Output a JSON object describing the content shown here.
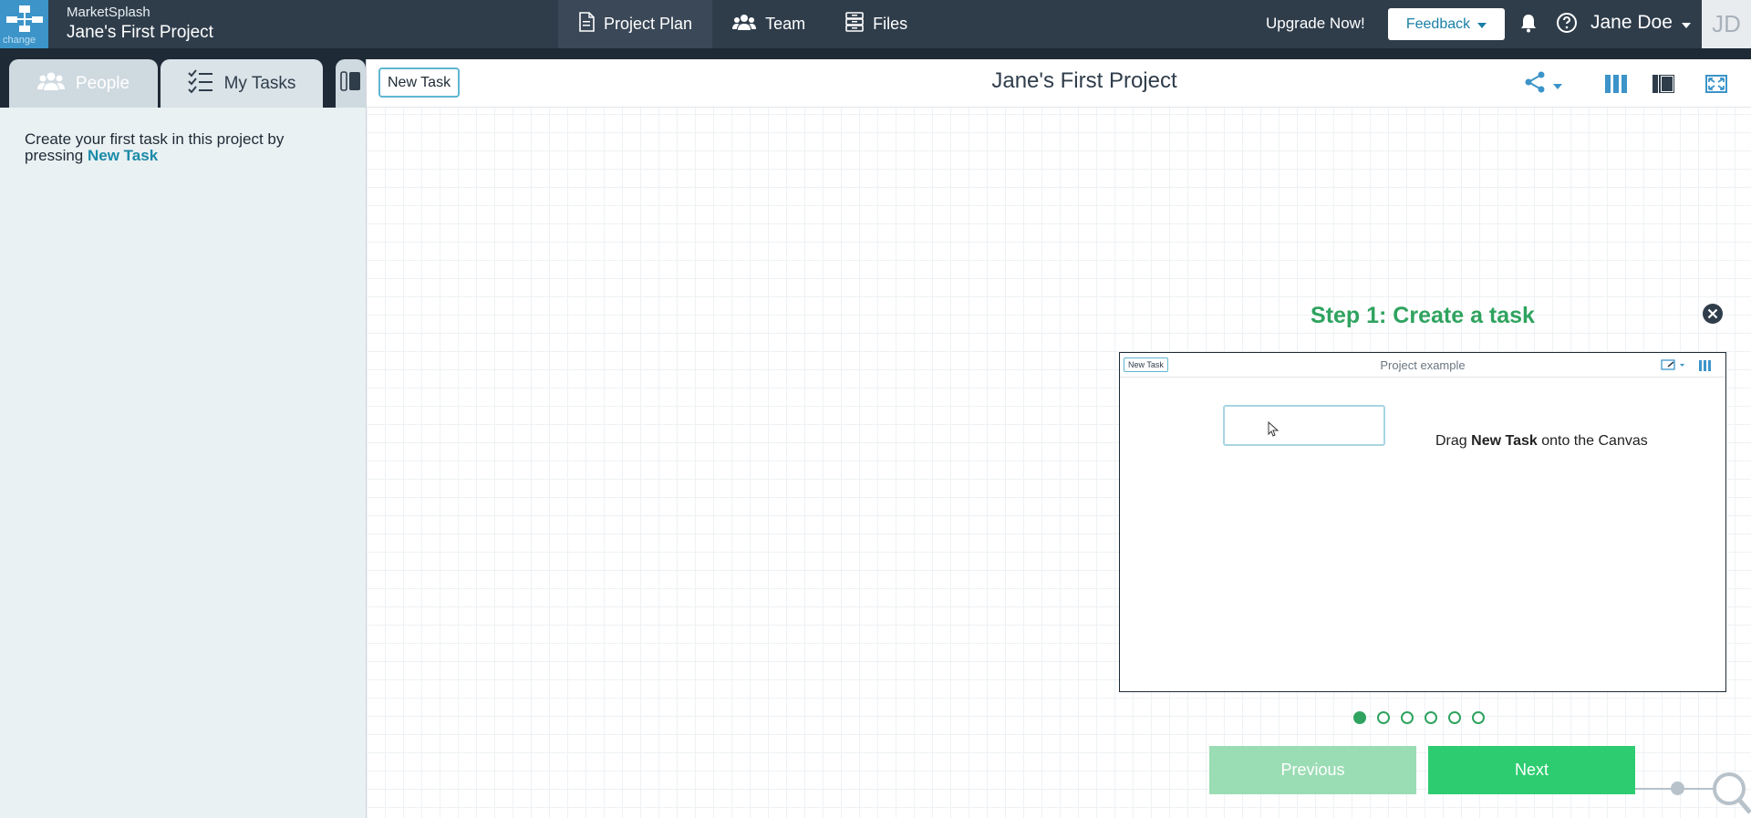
{
  "topbar": {
    "logo_sub": "change",
    "org_name": "MarketSplash",
    "project_name": "Jane's First Project",
    "tabs": [
      {
        "label": "Project Plan",
        "icon": "document-icon"
      },
      {
        "label": "Team",
        "icon": "team-icon"
      },
      {
        "label": "Files",
        "icon": "files-icon"
      }
    ],
    "upgrade_label": "Upgrade Now!",
    "feedback_label": "Feedback",
    "user_name": "Jane Doe",
    "avatar_initials": "JD"
  },
  "left_panel": {
    "tabs": [
      {
        "label": "People",
        "icon": "people-icon"
      },
      {
        "label": "My Tasks",
        "icon": "checklist-icon"
      }
    ],
    "message_prefix": "Create your first task in this project by pressing",
    "message_link": "New Task"
  },
  "canvas": {
    "new_task_label": "New Task",
    "title": "Jane's First Project"
  },
  "tutorial": {
    "title": "Step 1: Create a task",
    "example": {
      "new_task_label": "New Task",
      "title": "Project example",
      "instruction_prefix": "Drag",
      "instruction_bold": "New Task",
      "instruction_suffix": "onto the Canvas"
    },
    "steps_total": 6,
    "current_step": 1,
    "previous_label": "Previous",
    "next_label": "Next"
  },
  "colors": {
    "topbar": "#2f3d4b",
    "accent_green": "#2ecc71",
    "accent_blue": "#1a8aa8"
  }
}
